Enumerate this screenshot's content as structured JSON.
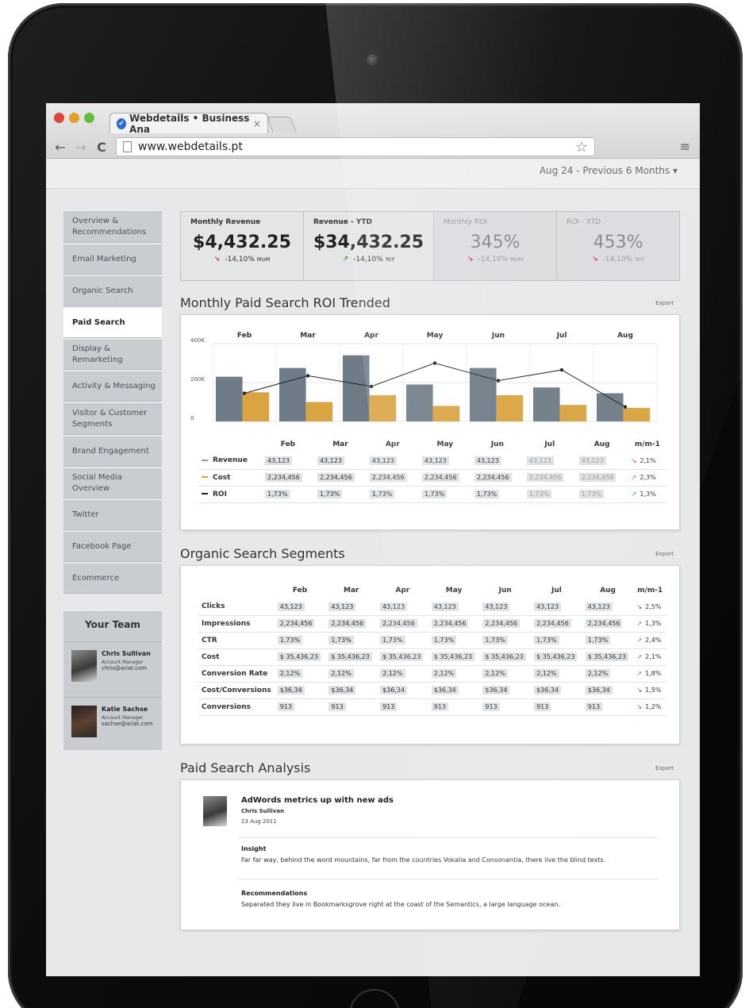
{
  "browser": {
    "tab_title": "Webdetails • Business Ana",
    "tab_close": "×",
    "url": "www.webdetails.pt"
  },
  "header": {
    "period": "Aug 24 - Previous 6 Months ▾"
  },
  "sidebar": {
    "items": [
      {
        "label": "Overview & Recommendations"
      },
      {
        "label": "Email Marketing"
      },
      {
        "label": "Organic Search"
      },
      {
        "label": "Paid Search"
      },
      {
        "label": "Display & Remarketing"
      },
      {
        "label": "Activity & Messaging"
      },
      {
        "label": "Visitor & Customer Segments"
      },
      {
        "label": "Brand Engagement"
      },
      {
        "label": "Social Media Overview"
      },
      {
        "label": "Twitter"
      },
      {
        "label": "Facebook Page"
      },
      {
        "label": "Ecommerce"
      }
    ],
    "active_index": 3,
    "team": {
      "title": "Your Team",
      "members": [
        {
          "name": "Chris Sullivan",
          "role": "Account Manager",
          "email": "chris@ariat.com"
        },
        {
          "name": "Katie Sachse",
          "role": "Account Manager",
          "email": "sachse@ariat.com"
        }
      ]
    }
  },
  "kpis": [
    {
      "title": "Monthly Revenue",
      "value": "$4,432.25",
      "delta": "-14,10%",
      "period": "MoM",
      "direction": "down"
    },
    {
      "title": "Revenue - YTD",
      "value": "$34,432.25",
      "delta": "-14,10%",
      "period": "YoY",
      "direction": "up"
    },
    {
      "title": "Monthly ROI",
      "value": "345%",
      "delta": "-14,10%",
      "period": "MoM",
      "direction": "down"
    },
    {
      "title": "ROI - YTD",
      "value": "453%",
      "delta": "-14,10%",
      "period": "YoY",
      "direction": "down"
    }
  ],
  "roi_section": {
    "title": "Monthly Paid Search ROI Trended",
    "export": "Export",
    "table": {
      "header": [
        "Feb",
        "Mar",
        "Apr",
        "May",
        "Jun",
        "Jul",
        "Aug",
        "m/m-1"
      ],
      "rows": [
        {
          "label": "Revenue",
          "values": [
            "43,123",
            "43,123",
            "43,123",
            "43,123",
            "43,123",
            "43,123",
            "43,123"
          ],
          "change": "2,1%",
          "dir": "down"
        },
        {
          "label": "Cost",
          "values": [
            "2,234,456",
            "2,234,456",
            "2,234,456",
            "2,234,456",
            "2,234,456",
            "2,234,456",
            "2,234,456"
          ],
          "change": "2,3%",
          "dir": "up"
        },
        {
          "label": "ROI",
          "values": [
            "1,73%",
            "1,73%",
            "1,73%",
            "1,73%",
            "1,73%",
            "1,73%",
            "1,73%"
          ],
          "change": "1,3%",
          "dir": "up"
        }
      ]
    }
  },
  "chart_data": {
    "type": "bar",
    "categories": [
      "Feb",
      "Mar",
      "Apr",
      "May",
      "Jun",
      "Jul",
      "Aug"
    ],
    "series": [
      {
        "name": "Revenue",
        "values": [
          230,
          275,
          340,
          190,
          275,
          175,
          145
        ],
        "kind": "bar",
        "color": "#6f7c87"
      },
      {
        "name": "Cost",
        "values": [
          150,
          100,
          135,
          80,
          135,
          85,
          70
        ],
        "kind": "bar",
        "color": "#d9a441"
      },
      {
        "name": "ROI",
        "values": [
          145,
          235,
          180,
          300,
          210,
          265,
          75
        ],
        "kind": "line",
        "color": "#222222"
      }
    ],
    "y_ticks": [
      "0",
      "200K",
      "400K"
    ],
    "ylim": [
      0,
      400
    ],
    "grid": true
  },
  "organic_section": {
    "title": "Organic Search Segments",
    "export": "Export",
    "header": [
      "Feb",
      "Mar",
      "Apr",
      "May",
      "Jun",
      "Jul",
      "Aug",
      "m/m-1"
    ],
    "rows": [
      {
        "label": "Clicks",
        "values": [
          "43,123",
          "43,123",
          "43,123",
          "43,123",
          "43,123",
          "43,123",
          "43,123"
        ],
        "change": "2,5%",
        "dir": "down"
      },
      {
        "label": "Impressions",
        "values": [
          "2,234,456",
          "2,234,456",
          "2,234,456",
          "2,234,456",
          "2,234,456",
          "2,234,456",
          "2,234,456"
        ],
        "change": "1,3%",
        "dir": "up"
      },
      {
        "label": "CTR",
        "values": [
          "1,73%",
          "1,73%",
          "1,73%",
          "1,73%",
          "1,73%",
          "1,73%",
          "1,73%"
        ],
        "change": "2,4%",
        "dir": "up"
      },
      {
        "label": "Cost",
        "values": [
          "$ 35,436,23",
          "$ 35,436,23",
          "$ 35,436,23",
          "$ 35,436,23",
          "$ 35,436,23",
          "$ 35,436,23",
          "$ 35,436,23"
        ],
        "change": "2,1%",
        "dir": "up"
      },
      {
        "label": "Conversion Rate",
        "values": [
          "2,12%",
          "2,12%",
          "2,12%",
          "2,12%",
          "2,12%",
          "2,12%",
          "2,12%"
        ],
        "change": "1,8%",
        "dir": "up"
      },
      {
        "label": "Cost/Conversions",
        "values": [
          "$36,34",
          "$36,34",
          "$36,34",
          "$36,34",
          "$36,34",
          "$36,34",
          "$36,34"
        ],
        "change": "1,5%",
        "dir": "down"
      },
      {
        "label": "Conversions",
        "values": [
          "913",
          "913",
          "913",
          "913",
          "913",
          "913",
          "913"
        ],
        "change": "1,2%",
        "dir": "down"
      }
    ]
  },
  "analysis_section": {
    "title": "Paid Search Analysis",
    "export": "Export",
    "post": {
      "title": "AdWords metrics up with new ads",
      "author": "Chris Sullivan",
      "date": "23 Aug 2011",
      "insight_heading": "Insight",
      "insight_text": "Far far way, behind the word mountains, far from the countries Vokalia and Consonantia, there live the blind texts.",
      "rec_heading": "Recommendations",
      "rec_text": "Separated they live in Bookmarksgrove right at the coast of the Semantics, a large language ocean."
    }
  }
}
